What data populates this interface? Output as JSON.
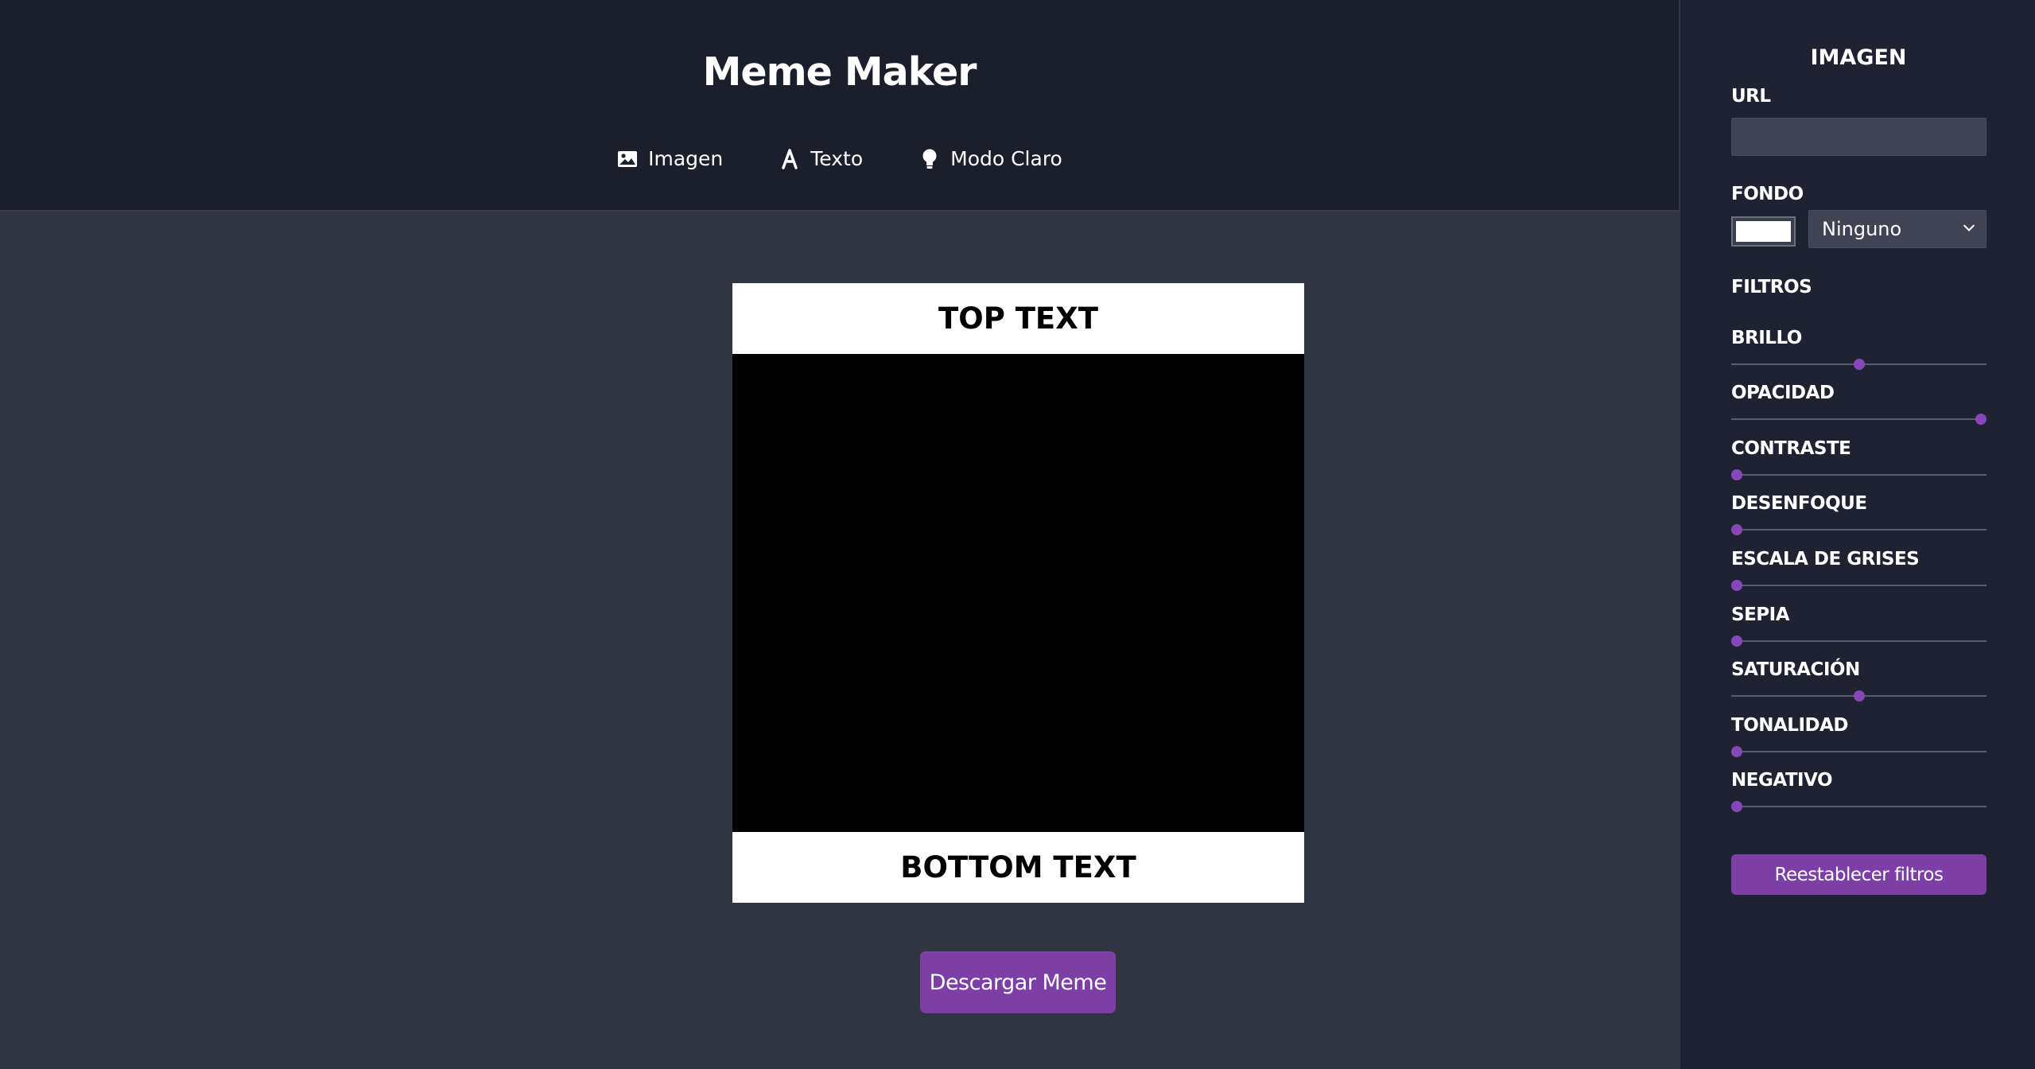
{
  "header": {
    "title": "Meme Maker",
    "nav": [
      {
        "label": "Imagen",
        "icon": "image-icon"
      },
      {
        "label": "Texto",
        "icon": "font-icon"
      },
      {
        "label": "Modo Claro",
        "icon": "lightbulb-icon"
      }
    ]
  },
  "meme": {
    "top_text": "TOP TEXT",
    "bottom_text": "BOTTOM TEXT",
    "background_color": "#000000",
    "text_background_color": "#ffffff"
  },
  "download_button": "Descargar Meme",
  "panel": {
    "title": "IMAGEN",
    "url_label": "URL",
    "url_value": "",
    "background_label": "FONDO",
    "background_color": "#ffffff",
    "blend_mode": "Ninguno",
    "filters_label": "FILTROS",
    "filters": [
      {
        "key": "brillo",
        "label": "BRILLO",
        "value": 0.5
      },
      {
        "key": "opacidad",
        "label": "OPACIDAD",
        "value": 1.0
      },
      {
        "key": "contraste",
        "label": "CONTRASTE",
        "value": 0.0
      },
      {
        "key": "desenfoque",
        "label": "DESENFOQUE",
        "value": 0.0
      },
      {
        "key": "grises",
        "label": "ESCALA DE GRISES",
        "value": 0.0
      },
      {
        "key": "sepia",
        "label": "SEPIA",
        "value": 0.0
      },
      {
        "key": "saturacion",
        "label": "SATURACIÓN",
        "value": 0.5
      },
      {
        "key": "tonalidad",
        "label": "TONALIDAD",
        "value": 0.0
      },
      {
        "key": "negativo",
        "label": "NEGATIVO",
        "value": 0.0
      }
    ],
    "reset_button": "Reestablecer filtros"
  },
  "colors": {
    "accent": "#7b3fa5",
    "header_bg": "#1b1f2c",
    "main_bg": "#313441",
    "sidebar_bg": "#1f2331"
  }
}
